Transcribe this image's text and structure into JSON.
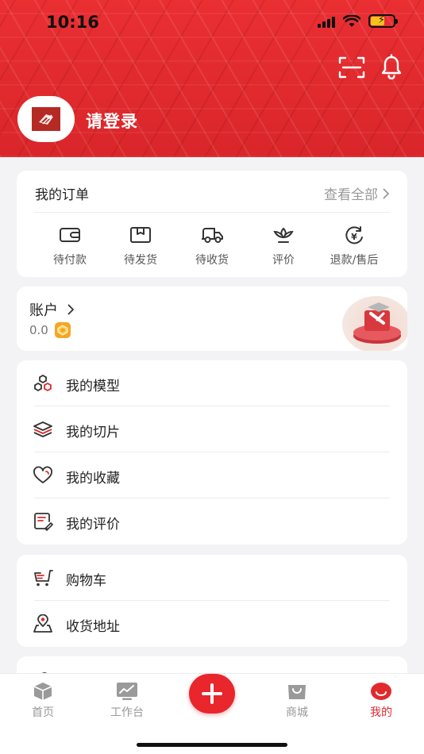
{
  "status_bar": {
    "time": "10:16"
  },
  "header": {
    "login_text": "请登录",
    "scan_icon": "scan-icon",
    "bell_icon": "bell-icon"
  },
  "orders": {
    "title": "我的订单",
    "view_all": "查看全部",
    "items": [
      {
        "label": "待付款",
        "icon": "wallet-icon"
      },
      {
        "label": "待发货",
        "icon": "box-icon"
      },
      {
        "label": "待收货",
        "icon": "truck-icon"
      },
      {
        "label": "评价",
        "icon": "lotus-icon"
      },
      {
        "label": "退款/售后",
        "icon": "refund-icon"
      }
    ]
  },
  "account": {
    "title": "账户",
    "balance": "0.0"
  },
  "menu_primary": [
    {
      "label": "我的模型",
      "icon": "hexagons-icon"
    },
    {
      "label": "我的切片",
      "icon": "layers-icon"
    },
    {
      "label": "我的收藏",
      "icon": "heart-icon"
    },
    {
      "label": "我的评价",
      "icon": "review-icon"
    }
  ],
  "menu_secondary": [
    {
      "label": "购物车",
      "icon": "cart-icon"
    },
    {
      "label": "收货地址",
      "icon": "location-icon"
    }
  ],
  "tabbar": [
    {
      "label": "首页",
      "icon": "cube-icon"
    },
    {
      "label": "工作台",
      "icon": "chart-icon"
    },
    {
      "label": "商城",
      "icon": "shopping-bag-icon"
    },
    {
      "label": "我的",
      "icon": "profile-icon"
    }
  ],
  "colors": {
    "brand": "#e02a2e",
    "text": "#222222",
    "muted": "#999999",
    "coin": "#f5a623"
  }
}
